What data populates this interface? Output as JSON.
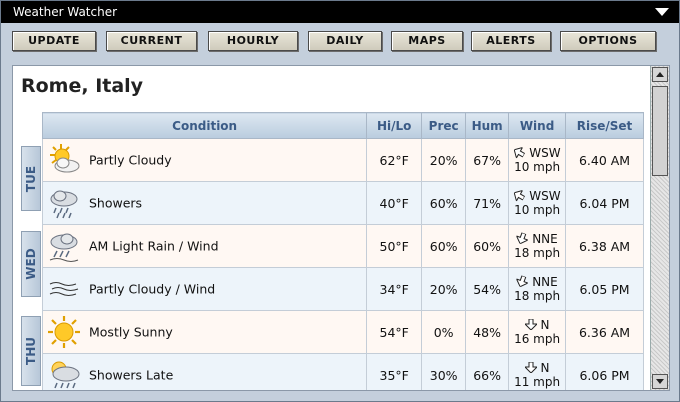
{
  "app": {
    "title": "Weather Watcher"
  },
  "toolbar": {
    "buttons": [
      "UPDATE",
      "CURRENT",
      "HOURLY",
      "DAILY",
      "MAPS",
      "ALERTS",
      "OPTIONS"
    ]
  },
  "location": "Rome, Italy",
  "table": {
    "headers": [
      "Condition",
      "Hi/Lo",
      "Prec",
      "Hum",
      "Wind",
      "Rise/Set"
    ],
    "rows": [
      {
        "icon": "partly-cloudy-icon",
        "condition": "Partly Cloudy",
        "hilo": "62°F",
        "prec": "20%",
        "hum": "67%",
        "wind_dir": "WSW",
        "wind_speed": "10 mph",
        "riseset": "6.40 AM"
      },
      {
        "icon": "showers-icon",
        "condition": "Showers",
        "hilo": "40°F",
        "prec": "60%",
        "hum": "71%",
        "wind_dir": "WSW",
        "wind_speed": "10 mph",
        "riseset": "6.04 PM"
      },
      {
        "icon": "rain-wind-icon",
        "condition": "AM Light Rain / Wind",
        "hilo": "50°F",
        "prec": "60%",
        "hum": "60%",
        "wind_dir": "NNE",
        "wind_speed": "18 mph",
        "riseset": "6.38 AM"
      },
      {
        "icon": "partly-cloudy-wind-icon",
        "condition": "Partly Cloudy / Wind",
        "hilo": "34°F",
        "prec": "20%",
        "hum": "54%",
        "wind_dir": "NNE",
        "wind_speed": "18 mph",
        "riseset": "6.05 PM"
      },
      {
        "icon": "sunny-icon",
        "condition": "Mostly Sunny",
        "hilo": "54°F",
        "prec": "0%",
        "hum": "48%",
        "wind_dir": "N",
        "wind_speed": "16 mph",
        "riseset": "6.36 AM"
      },
      {
        "icon": "showers-late-icon",
        "condition": "Showers Late",
        "hilo": "35°F",
        "prec": "30%",
        "hum": "66%",
        "wind_dir": "N",
        "wind_speed": "11 mph",
        "riseset": "6.06 PM"
      }
    ]
  },
  "days": [
    "TUE",
    "WED",
    "THU"
  ],
  "colors": {
    "header_text": "#3b5b86",
    "row_odd": "#fff8f3",
    "row_even": "#edf4fa"
  }
}
